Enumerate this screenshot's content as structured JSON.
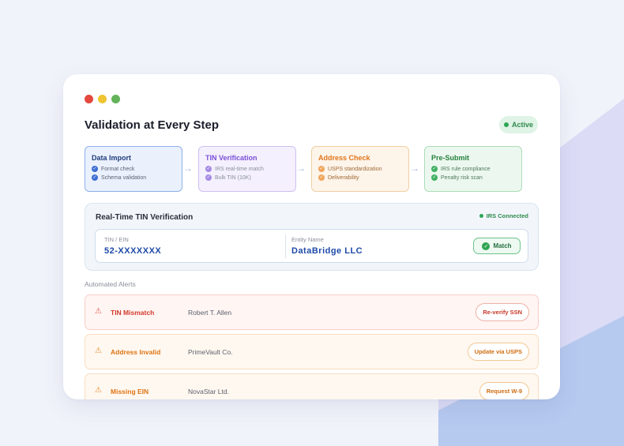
{
  "window": {
    "title": "Validation at Every Step",
    "status": "Active"
  },
  "steps": [
    {
      "title": "Data Import",
      "items": [
        "Format check",
        "Schema validation"
      ]
    },
    {
      "title": "TIN Verification",
      "items": [
        "IRS real-time match",
        "Bulk TIN (10K)"
      ]
    },
    {
      "title": "Address Check",
      "items": [
        "USPS standardization",
        "Deliverability"
      ]
    },
    {
      "title": "Pre-Submit",
      "items": [
        "IRS rule compliance",
        "Penalty risk scan"
      ]
    }
  ],
  "tin": {
    "title": "Real-Time TIN Verification",
    "connection": "IRS Connected",
    "tin_label": "TIN / EIN",
    "tin_value": "52-XXXXXXX",
    "entity_label": "Entity Name",
    "entity_value": "DataBridge LLC",
    "match_label": "Match"
  },
  "alerts": {
    "heading": "Automated Alerts",
    "items": [
      {
        "name": "TIN Mismatch",
        "payee": "Robert T. Allen",
        "action": "Re-verify SSN"
      },
      {
        "name": "Address Invalid",
        "payee": "PrimeVault Co.",
        "action": "Update via USPS"
      },
      {
        "name": "Missing EIN",
        "payee": "NovaStar Ltd.",
        "action": "Request W-9"
      }
    ]
  },
  "colors": {
    "background": "#f1f3fa",
    "accent_purple": "#d8d9f5",
    "accent_blue": "#b3c8ef",
    "success": "#2ea552",
    "error": "#d33a2c",
    "warning": "#de7414"
  },
  "icons": {
    "window_controls": [
      "close-dot",
      "minimize-dot",
      "maximize-dot"
    ],
    "step_item": "check-circle-icon",
    "flow": "arrow-right-icon",
    "alert": "warning-triangle-icon",
    "match": "check-circle-icon"
  }
}
